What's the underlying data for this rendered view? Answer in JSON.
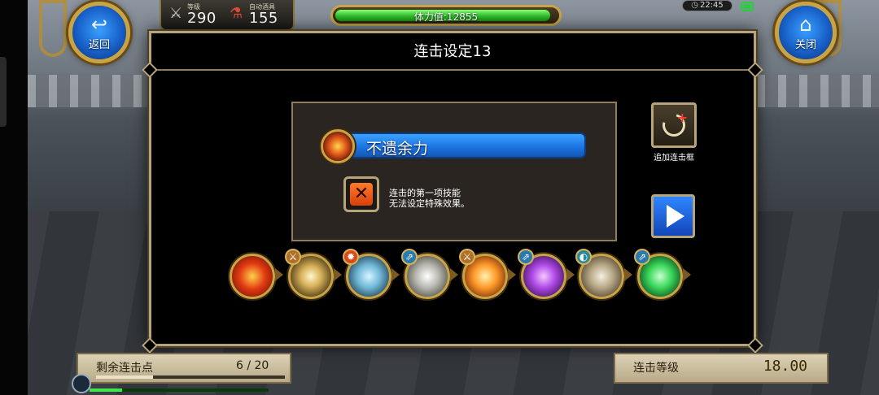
{
  "top_hud": {
    "back_label": "返回",
    "close_label": "关闭",
    "level_caption": "等级",
    "level_value": "290",
    "auto_potion_caption": "自动酒具",
    "auto_potion_value": "155",
    "stamina_text": "体力值:12855",
    "stamina_fraction": 0.97,
    "clock": "22:45",
    "battery_color": "#2ecc40"
  },
  "dialog": {
    "title": "连击设定13",
    "skill_name": "不遗余力",
    "warning": "连击的第一项技能\n无法设定特殊效果。",
    "add_frame_label": "追加连击框"
  },
  "skill_row": [
    {
      "icon": "red-slash-icon",
      "badge": ""
    },
    {
      "icon": "golden-burst-icon",
      "badge": "sword-badge"
    },
    {
      "icon": "ice-shield-icon",
      "badge": "fire-badge"
    },
    {
      "icon": "white-blade-icon",
      "badge": "boot-badge"
    },
    {
      "icon": "sun-burst-icon",
      "badge": "sword-badge"
    },
    {
      "icon": "purple-lightning-icon",
      "badge": "boot-badge"
    },
    {
      "icon": "cage-icon",
      "badge": "shield-badge"
    },
    {
      "icon": "green-figure-icon",
      "badge": "boot-badge"
    }
  ],
  "bottom": {
    "remaining_label": "剩余连击点",
    "remaining_value": "6 / 20",
    "remaining_fraction": 0.3,
    "combo_level_label": "连击等级",
    "combo_level_value": "18.00"
  },
  "colors": {
    "accent_gold": "#c9a447",
    "skill_bar_blue": "#1b72e0",
    "stamina_green": "#2fbf2a"
  }
}
